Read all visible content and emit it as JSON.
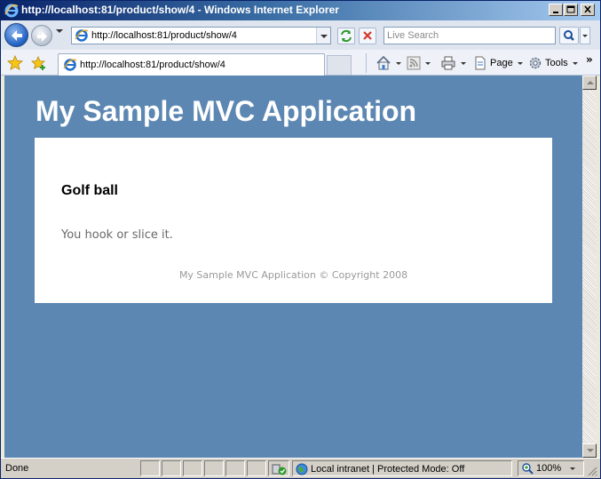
{
  "window": {
    "title": "http://localhost:81/product/show/4 - Windows Internet Explorer"
  },
  "address_bar": {
    "url": "http://localhost:81/product/show/4",
    "search_placeholder": "Live Search"
  },
  "tabs": [
    {
      "label": "http://localhost:81/product/show/4",
      "active": true
    }
  ],
  "command_bar": {
    "page_label": "Page",
    "tools_label": "Tools",
    "more_label": "»"
  },
  "page": {
    "site_title": "My Sample MVC Application",
    "product_name": "Golf ball",
    "product_description": "You hook or slice it.",
    "footer": "My Sample MVC Application © Copyright 2008",
    "colors": {
      "background": "#5c87b2",
      "panel": "#ffffff",
      "heading": "#ffffff",
      "description": "#696969",
      "footer": "#999999"
    }
  },
  "status_bar": {
    "status": "Done",
    "zone": "Local intranet | Protected Mode: Off",
    "zoom": "100%"
  },
  "icons": {
    "title": "ie-logo-icon",
    "back": "back-arrow-icon",
    "forward": "forward-arrow-icon",
    "refresh": "refresh-icon",
    "stop": "stop-icon",
    "search": "magnifier-icon",
    "favorites": "star-icon",
    "add_favorites": "star-plus-icon",
    "home": "home-icon",
    "feeds": "rss-icon",
    "print": "printer-icon",
    "page": "page-icon",
    "tools": "gear-icon",
    "zone": "globe-icon",
    "zoom": "magnifier-zoom-icon"
  }
}
